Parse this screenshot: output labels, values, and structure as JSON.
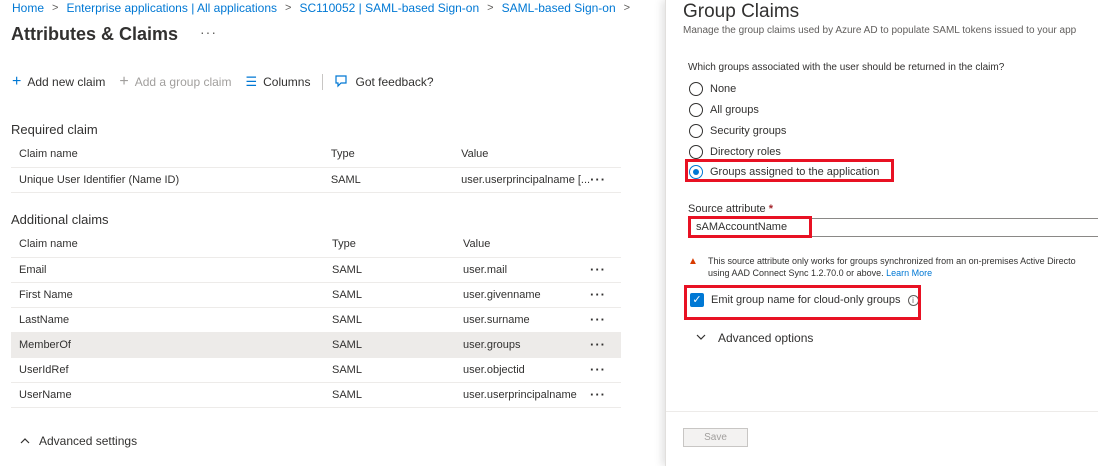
{
  "breadcrumb": [
    "Home",
    "Enterprise applications | All applications",
    "SC110052 | SAML-based Sign-on",
    "SAML-based Sign-on"
  ],
  "page": {
    "title": "Attributes & Claims",
    "more": "···"
  },
  "toolbar": {
    "add_new_claim": "Add new claim",
    "add_group_claim": "Add a group claim",
    "columns": "Columns",
    "feedback": "Got feedback?"
  },
  "required": {
    "heading": "Required claim",
    "columns": [
      "Claim name",
      "Type",
      "Value"
    ],
    "rows": [
      {
        "name": "Unique User Identifier (Name ID)",
        "type": "SAML",
        "value": "user.userprincipalname [..."
      }
    ]
  },
  "additional": {
    "heading": "Additional claims",
    "columns": [
      "Claim name",
      "Type",
      "Value"
    ],
    "rows": [
      {
        "name": "Email",
        "type": "SAML",
        "value": "user.mail"
      },
      {
        "name": "First Name",
        "type": "SAML",
        "value": "user.givenname"
      },
      {
        "name": "LastName",
        "type": "SAML",
        "value": "user.surname"
      },
      {
        "name": "MemberOf",
        "type": "SAML",
        "value": "user.groups"
      },
      {
        "name": "UserIdRef",
        "type": "SAML",
        "value": "user.objectid"
      },
      {
        "name": "UserName",
        "type": "SAML",
        "value": "user.userprincipalname"
      }
    ]
  },
  "advanced_settings": "Advanced settings",
  "panel": {
    "title": "Group Claims",
    "subtitle": "Manage the group claims used by Azure AD to populate SAML tokens issued to your app",
    "question": "Which groups associated with the user should be returned in the claim?",
    "options": [
      "None",
      "All groups",
      "Security groups",
      "Directory roles",
      "Groups assigned to the application"
    ],
    "selected_option": "Groups assigned to the application",
    "source_label": "Source attribute",
    "required_mark": "*",
    "source_value": "sAMAccountName",
    "warning_line1": "This source attribute only works for groups synchronized from an on-premises Active Directo",
    "warning_line2": "using AAD Connect Sync 1.2.70.0 or above.",
    "learn_more": "Learn More",
    "emit_label": "Emit group name for cloud-only groups",
    "emit_checked": true,
    "advanced_options": "Advanced options",
    "save": "Save"
  },
  "colors": {
    "accent": "#0078d4",
    "highlight": "#e81123",
    "warning": "#d83b01"
  }
}
